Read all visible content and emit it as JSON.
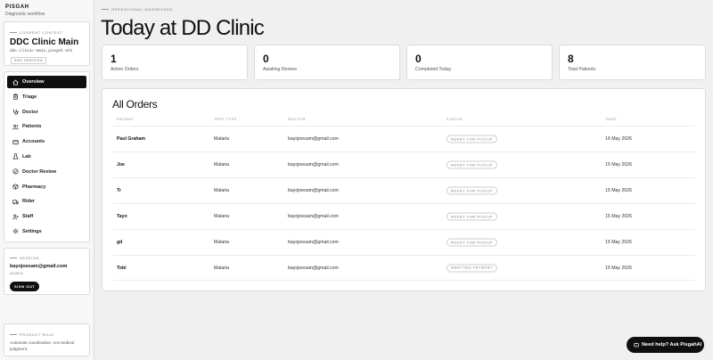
{
  "brand": {
    "name": "PISGAH",
    "subtitle": "Diagnostic workflow"
  },
  "context": {
    "kicker": "CURRENT CONTEXT",
    "title": "DDC Clinic Main",
    "slug": "ddc-clinic-main.pisgah.eth",
    "badge": "ENS VERIFIED"
  },
  "nav": [
    {
      "label": "Overview",
      "icon": "home-icon",
      "active": true
    },
    {
      "label": "Triage",
      "icon": "clipboard-icon"
    },
    {
      "label": "Doctor",
      "icon": "stethoscope-icon"
    },
    {
      "label": "Patients",
      "icon": "users-icon"
    },
    {
      "label": "Accounts",
      "icon": "wallet-icon"
    },
    {
      "label": "Lab",
      "icon": "flask-icon"
    },
    {
      "label": "Doctor Review",
      "icon": "check-circle-icon"
    },
    {
      "label": "Pharmacy",
      "icon": "pill-box-icon"
    },
    {
      "label": "Rider",
      "icon": "truck-icon"
    },
    {
      "label": "Staff",
      "icon": "user-plus-icon"
    },
    {
      "label": "Settings",
      "icon": "gear-icon"
    }
  ],
  "session": {
    "kicker": "SESSION",
    "email": "bayojoesam@gmail.com",
    "role": "ADMIN",
    "signout_label": "SIGN OUT"
  },
  "product_rule": {
    "kicker": "PRODUCT RULE",
    "text": "Automate coordination, not medical judgment."
  },
  "header": {
    "eyebrow": "OPERATIONAL DASHBOARD",
    "title": "Today at DD Clinic"
  },
  "stats": [
    {
      "value": "1",
      "label": "Active Orders"
    },
    {
      "value": "0",
      "label": "Awaiting Review"
    },
    {
      "value": "0",
      "label": "Completed Today"
    },
    {
      "value": "8",
      "label": "Total Patients"
    }
  ],
  "orders": {
    "title": "All Orders",
    "columns": [
      "PATIENT",
      "TEST TYPE",
      "DOCTOR",
      "STATUS",
      "DATE"
    ],
    "rows": [
      {
        "patient": "Paul Graham",
        "test": "Malaria",
        "doctor": "bayojoesam@gmail.com",
        "status": "READY FOR PICKUP",
        "date": "16 May 2026"
      },
      {
        "patient": "Joe",
        "test": "Malaria",
        "doctor": "bayojoesam@gmail.com",
        "status": "READY FOR PICKUP",
        "date": "15 May 2026"
      },
      {
        "patient": "Tr",
        "test": "Malaria",
        "doctor": "bayojoesam@gmail.com",
        "status": "READY FOR PICKUP",
        "date": "15 May 2026"
      },
      {
        "patient": "Tayo",
        "test": "Malaria",
        "doctor": "bayojoesam@gmail.com",
        "status": "READY FOR PICKUP",
        "date": "15 May 2026"
      },
      {
        "patient": "gd",
        "test": "Malaria",
        "doctor": "bayojoesam@gmail.com",
        "status": "READY FOR PICKUP",
        "date": "15 May 2026"
      },
      {
        "patient": "Tobi",
        "test": "Malaria",
        "doctor": "bayojoesam@gmail.com",
        "status": "AWAITING PAYMENT",
        "date": "15 May 2026"
      }
    ]
  },
  "help": {
    "label": "Need help? Ask PisgahAI",
    "icon": "chat-bot-icon"
  }
}
